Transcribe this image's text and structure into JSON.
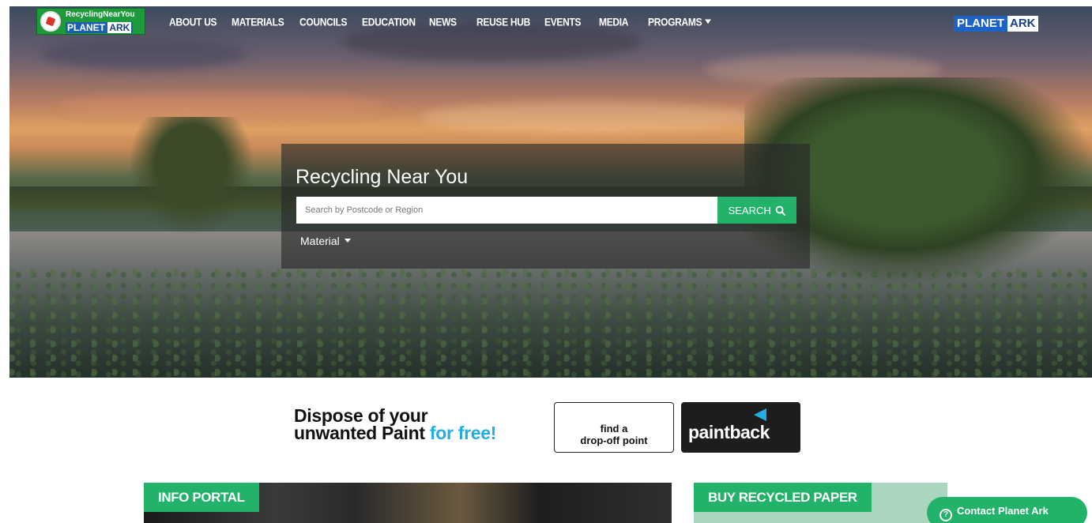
{
  "logo": {
    "line1": "RecyclingNearYou",
    "line2_part1": "PLANET",
    "line2_part2": "ARK"
  },
  "nav": {
    "items": [
      "ABOUT US",
      "MATERIALS",
      "COUNCILS",
      "EDUCATION",
      "NEWS",
      "REUSE HUB",
      "EVENTS",
      "MEDIA",
      "PROGRAMS"
    ]
  },
  "brand_logo": {
    "part1": "PLANET",
    "part2": "ARK"
  },
  "search": {
    "title": "Recycling Near You",
    "placeholder": "Search by Postcode or Region",
    "value": "",
    "button_label": "SEARCH",
    "material_label": "Material"
  },
  "banner": {
    "line1": "Dispose of your",
    "line2": "unwanted Paint",
    "line2_highlight": "for free!",
    "cta_line1": "find a",
    "cta_line2": "drop-off point",
    "brand_word": "paintback"
  },
  "cards": {
    "info_portal": "INFO PORTAL",
    "buy_paper": "BUY RECYCLED PAPER"
  },
  "contact": {
    "label": "Contact Planet Ark",
    "icon_text": "?"
  },
  "colors": {
    "accent_green": "#22b26a",
    "paint_blue": "#22aee4",
    "brand_blue": "#1b63c6"
  }
}
